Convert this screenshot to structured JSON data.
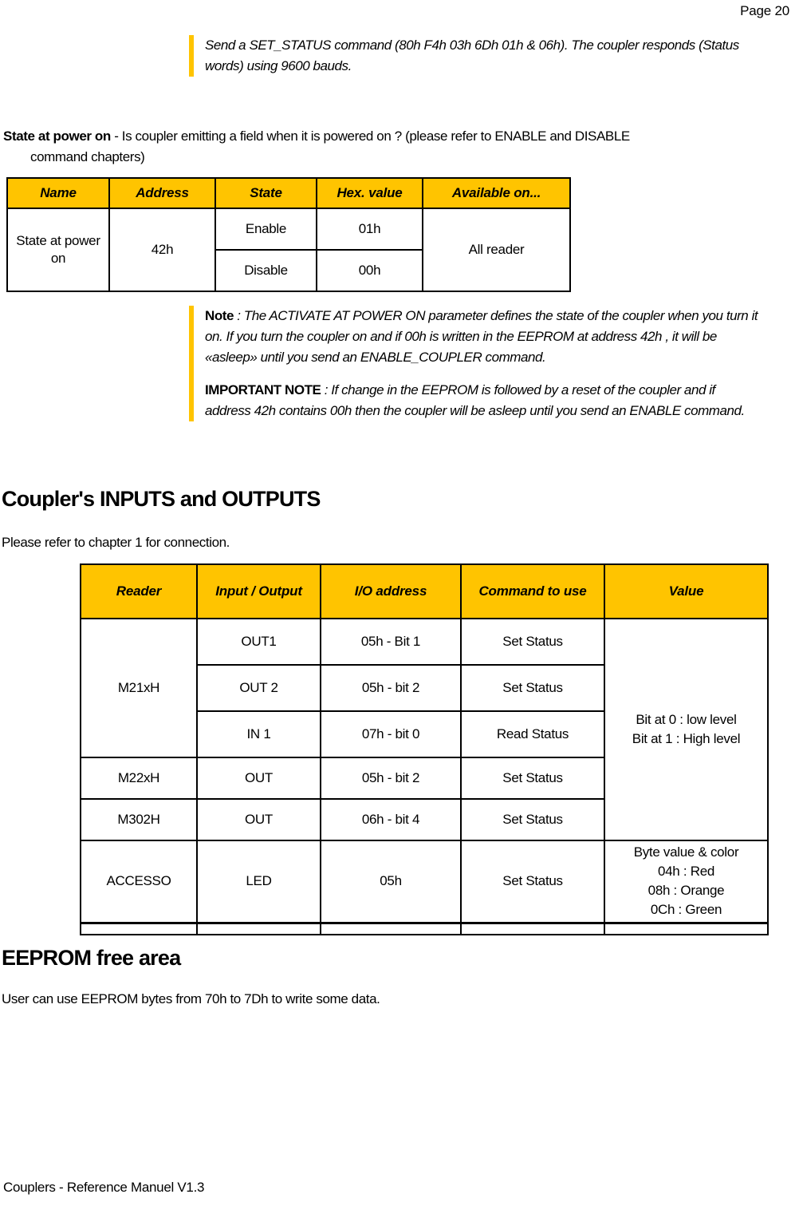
{
  "header": {
    "page_label": "Page 20"
  },
  "footer": {
    "text": "Couplers - Reference Manuel V1.3"
  },
  "send_callout": {
    "line": "Send a SET_STATUS command (80h F4h 03h 6Dh 01h & 06h). The coupler responds (Status words) using 9600 bauds."
  },
  "state_power_section": {
    "lead_bold": "State at power on",
    "lead_rest": " - Is coupler emitting a field when it is powered on ? (please refer to ENABLE and DISABLE",
    "lead_indent": "command chapters)"
  },
  "table_state": {
    "headers": [
      "Name",
      "Address",
      "State",
      "Hex. value",
      "Available on..."
    ],
    "name": "State at power on",
    "address": "42h",
    "available_on": "All reader",
    "rows": [
      {
        "state": "Enable",
        "hex": "01h"
      },
      {
        "state": "Disable",
        "hex": "00h"
      }
    ]
  },
  "note_callout": {
    "note_label": "Note",
    "note_body": " : The ACTIVATE AT POWER ON  parameter defines the state of the coupler when you turn it on. If you turn the coupler on and if 00h is written in the EEPROM at address 42h , it will be «asleep» until you send an ENABLE_COUPLER command.",
    "important_label": "IMPORTANT NOTE",
    "important_body": " : If change in the EEPROM is followed by a reset of the coupler and if address 42h contains 00h then the coupler will be asleep until you send an ENABLE command."
  },
  "io_section": {
    "heading": "Coupler's INPUTS and OUTPUTS",
    "refer_text": "Please refer to chapter 1 for connection."
  },
  "table_io": {
    "headers": [
      "Reader",
      "Input / Output",
      "I/O address",
      "Command to use",
      "Value"
    ],
    "reader_m21": "M21xH",
    "reader_m22": "M22xH",
    "reader_m302": "M302H",
    "reader_accesso": "ACCESSO",
    "value_bits_line1": "Bit at 0 : low level",
    "value_bits_line2": "Bit at 1 : High level",
    "value_color_line1": "Byte value & color",
    "value_color_line2": "04h : Red",
    "value_color_line3": "08h : Orange",
    "value_color_line4": "0Ch : Green",
    "rows": [
      {
        "io": "OUT1",
        "addr": "05h - Bit 1",
        "cmd": "Set Status"
      },
      {
        "io": "OUT 2",
        "addr": "05h - bit 2",
        "cmd": "Set Status"
      },
      {
        "io": "IN 1",
        "addr": "07h - bit 0",
        "cmd": "Read Status"
      },
      {
        "io": "OUT",
        "addr": "05h - bit 2",
        "cmd": "Set Status"
      },
      {
        "io": "OUT",
        "addr": "06h - bit 4",
        "cmd": "Set Status"
      },
      {
        "io": "LED",
        "addr": "05h",
        "cmd": "Set Status"
      }
    ]
  },
  "eeprom_section": {
    "heading": "EEPROM free area",
    "text": "User can use EEPROM bytes from 70h to 7Dh to write some data."
  },
  "colors": {
    "accent_yellow": "#FFC400",
    "table_border": "#000000",
    "text": "#000000"
  }
}
